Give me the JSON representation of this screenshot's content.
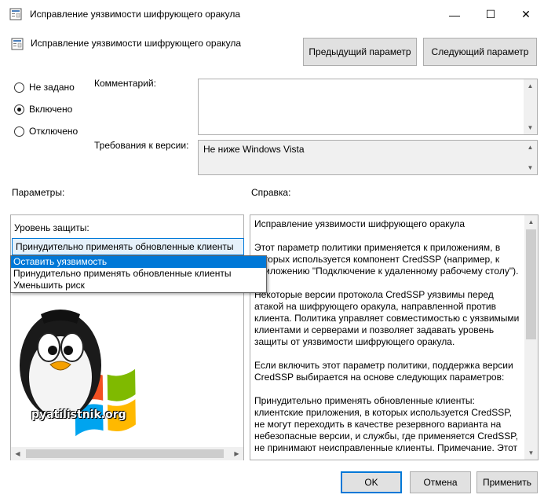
{
  "window": {
    "title": "Исправление уязвимости шифрующего оракула",
    "controls": {
      "minimize": "—",
      "maximize": "☐",
      "close": "✕"
    }
  },
  "header": {
    "policy_name": "Исправление уязвимости шифрующего оракула",
    "prev_button": "Предыдущий параметр",
    "next_button": "Следующий параметр"
  },
  "state": {
    "options": [
      {
        "label": "Не задано",
        "checked": false
      },
      {
        "label": "Включено",
        "checked": true
      },
      {
        "label": "Отключено",
        "checked": false
      }
    ]
  },
  "comment": {
    "label": "Комментарий:",
    "value": ""
  },
  "version": {
    "label": "Требования к версии:",
    "value": "Не ниже Windows Vista"
  },
  "params": {
    "label": "Параметры:",
    "protection_label": "Уровень защиты:",
    "selected_value": "Принудительно применять обновленные клиенты",
    "dropdown_options": [
      {
        "label": "Оставить уязвимость",
        "highlighted": true
      },
      {
        "label": "Принудительно применять обновленные клиенты",
        "highlighted": false
      },
      {
        "label": "Уменьшить риск",
        "highlighted": false
      }
    ],
    "logo_text": "pyatilistnik.org"
  },
  "help": {
    "label": "Справка:",
    "paragraphs": [
      "Исправление уязвимости шифрующего оракула",
      "Этот параметр политики применяется к приложениям, в которых используется компонент CredSSP (например, к приложению \"Подключение к удаленному рабочему столу\").",
      "Некоторые версии протокола CredSSP уязвимы перед атакой на шифрующего оракула, направленной против клиента. Политика управляет совместимостью с уязвимыми клиентами и серверами и позволяет задавать уровень защиты от уязвимости шифрующего оракула.",
      "Если включить этот параметр политики, поддержка версии CredSSP выбирается на основе следующих параметров:",
      "Принудительно применять обновленные клиенты: клиентские приложения, в которых используется CredSSP, не могут переходить в качестве резервного варианта на небезопасные версии, и службы, где применяется CredSSP, не принимают неисправленные клиенты. Примечание. Этот"
    ]
  },
  "footer": {
    "ok": "OK",
    "cancel": "Отмена",
    "apply": "Применить"
  },
  "colors": {
    "accent": "#0078d7",
    "button_bg": "#e1e1e1",
    "readonly_bg": "#f0f0f0"
  }
}
